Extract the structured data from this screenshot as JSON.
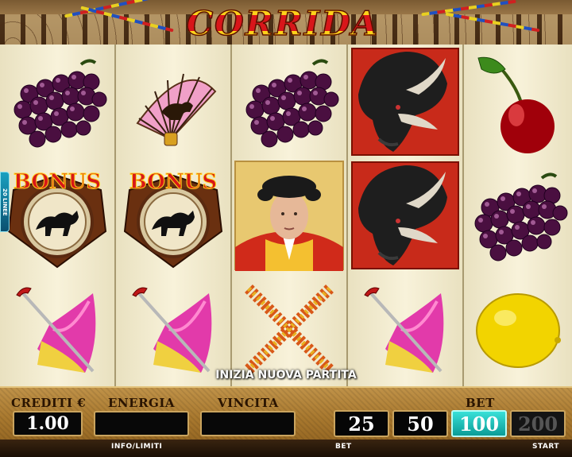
{
  "title": "CORRIDA",
  "lines_badge": "20 LINEE",
  "message": "INIZIA NUOVA PARTITA",
  "reels": [
    [
      "grapes-icon",
      "bonus-icon",
      "cape-sword-icon"
    ],
    [
      "fan-icon",
      "bonus-icon",
      "cape-sword-icon"
    ],
    [
      "grapes-icon",
      "matador-icon",
      "banderillas-icon"
    ],
    [
      "bull-icon",
      "bull-icon",
      "cape-sword-icon"
    ],
    [
      "cherry-icon",
      "grapes-icon",
      "lemon-icon"
    ]
  ],
  "bonus_text": "BONUS",
  "panel": {
    "credits_label": "CREDITI €",
    "credits_value": "1.00",
    "energy_label": "ENERGIA",
    "energy_value": "",
    "win_label": "VINCITA",
    "win_value": "",
    "bet_label": "BET",
    "bet_options": [
      "25",
      "50",
      "100",
      "200"
    ],
    "bet_selected": "100",
    "info_label": "INFO/LIMITI",
    "bet_small_label": "BET",
    "start_label": "START"
  },
  "colors": {
    "accent": "#1fc4bc",
    "panel": "#a8782e",
    "reel_bg": "#f3ecd0"
  }
}
